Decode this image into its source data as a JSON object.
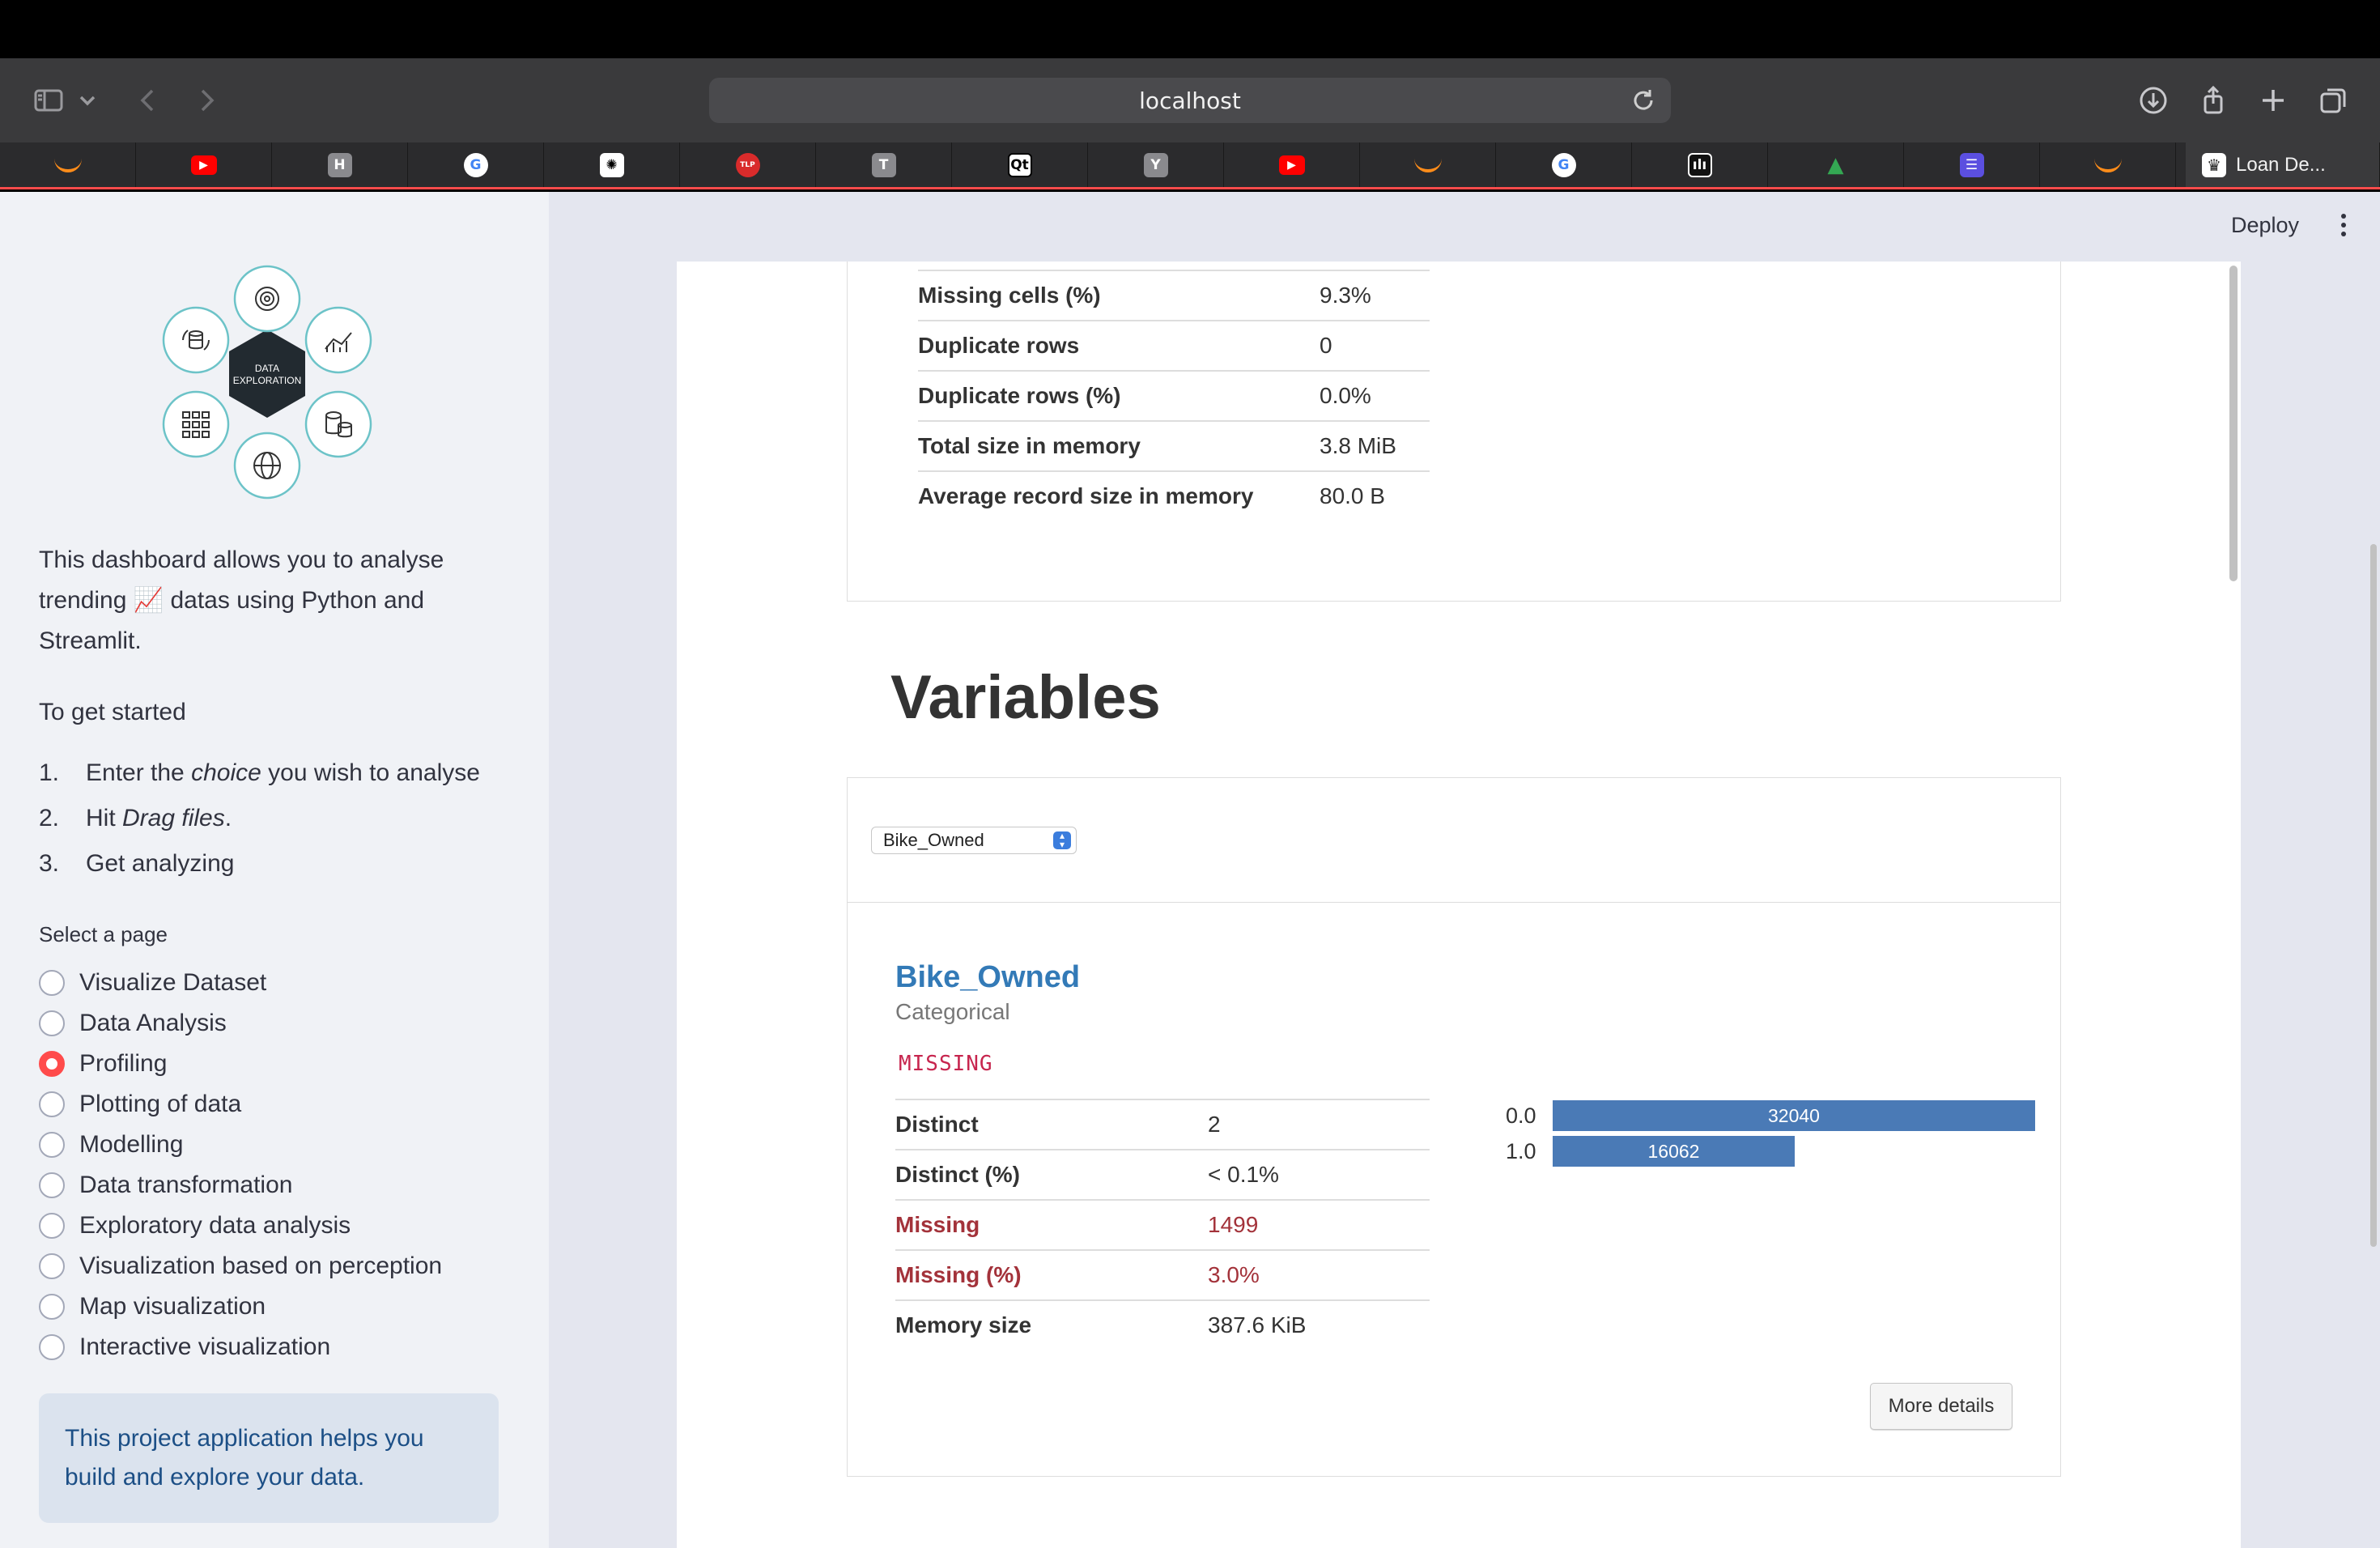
{
  "browser": {
    "url": "localhost",
    "active_tab_title": "Loan De..."
  },
  "tabs": [
    {
      "icon": "streamlit-icon",
      "color": "#ff8c1a",
      "glyph": ""
    },
    {
      "icon": "youtube-icon",
      "color": "#ff0000",
      "glyph": "▶"
    },
    {
      "icon": "h-icon",
      "color": "#8a8a8e",
      "glyph": "H"
    },
    {
      "icon": "google-icon",
      "color": "#ffffff",
      "glyph": "G"
    },
    {
      "icon": "chatgpt-icon",
      "color": "#ffffff",
      "glyph": "✺"
    },
    {
      "icon": "tlp-icon",
      "color": "#d92b2b",
      "glyph": "TLP"
    },
    {
      "icon": "t-icon",
      "color": "#8a8a8e",
      "glyph": "T"
    },
    {
      "icon": "qt-icon",
      "color": "#ffffff",
      "glyph": "Qt"
    },
    {
      "icon": "y-icon",
      "color": "#8a8a8e",
      "glyph": "Y"
    },
    {
      "icon": "youtube-icon",
      "color": "#ff0000",
      "glyph": "▶"
    },
    {
      "icon": "streamlit-icon",
      "color": "#ff8c1a",
      "glyph": ""
    },
    {
      "icon": "google-icon",
      "color": "#ffffff",
      "glyph": "G"
    },
    {
      "icon": "chart-app-icon",
      "color": "#ffffff",
      "glyph": "ılı"
    },
    {
      "icon": "google-drive-icon",
      "color": "#34a853",
      "glyph": "▲"
    },
    {
      "icon": "list-app-icon",
      "color": "#5b4fe0",
      "glyph": "☰"
    },
    {
      "icon": "streamlit-icon",
      "color": "#ff8c1a",
      "glyph": ""
    }
  ],
  "sidebar": {
    "hero_center_label_1": "DATA",
    "hero_center_label_2": "EXPLORATION",
    "intro_line_1": "This dashboard allows you to analyse",
    "intro_line_2a": "trending",
    "intro_emoji": "📈",
    "intro_line_2b": "datas using Python and",
    "intro_line_3": "Streamlit.",
    "get_started": "To get started",
    "steps": [
      {
        "num": "1.",
        "pre": "Enter the ",
        "em": "choice",
        "post": " you wish to analyse"
      },
      {
        "num": "2.",
        "pre": "Hit ",
        "em": "Drag files",
        "post": "."
      },
      {
        "num": "3.",
        "pre": "Get analyzing",
        "em": "",
        "post": ""
      }
    ],
    "select_label": "Select a page",
    "pages": [
      {
        "label": "Visualize Dataset",
        "checked": false
      },
      {
        "label": "Data Analysis",
        "checked": false
      },
      {
        "label": "Profiling",
        "checked": true
      },
      {
        "label": "Plotting of data",
        "checked": false
      },
      {
        "label": "Modelling",
        "checked": false
      },
      {
        "label": "Data transformation",
        "checked": false
      },
      {
        "label": "Exploratory data analysis",
        "checked": false
      },
      {
        "label": "Visualization based on perception",
        "checked": false
      },
      {
        "label": "Map visualization",
        "checked": false
      },
      {
        "label": "Interactive visualization",
        "checked": false
      }
    ],
    "info_line_1": "This project application helps you",
    "info_line_2": "build and explore your data."
  },
  "header": {
    "deploy_label": "Deploy"
  },
  "overview": {
    "rows": [
      {
        "k": "Missing cells (%)",
        "v": "9.3%"
      },
      {
        "k": "Duplicate rows",
        "v": "0"
      },
      {
        "k": "Duplicate rows (%)",
        "v": "0.0%"
      },
      {
        "k": "Total size in memory",
        "v": "3.8 MiB"
      },
      {
        "k": "Average record size in memory",
        "v": "80.0 B"
      }
    ]
  },
  "variables": {
    "title": "Variables",
    "selected": "Bike_Owned",
    "name": "Bike_Owned",
    "type": "Categorical",
    "badge": "MISSING",
    "stats": [
      {
        "k": "Distinct",
        "v": "2",
        "alert": false
      },
      {
        "k": "Distinct (%)",
        "v": "< 0.1%",
        "alert": false
      },
      {
        "k": "Missing",
        "v": "1499",
        "alert": true
      },
      {
        "k": "Missing (%)",
        "v": "3.0%",
        "alert": true
      },
      {
        "k": "Memory size",
        "v": "387.6 KiB",
        "alert": false
      }
    ],
    "more_details": "More details",
    "bar_color": "#4a7ab6"
  },
  "chart_data": {
    "type": "bar",
    "categories": [
      "0.0",
      "1.0"
    ],
    "values": [
      32040,
      16062
    ]
  }
}
